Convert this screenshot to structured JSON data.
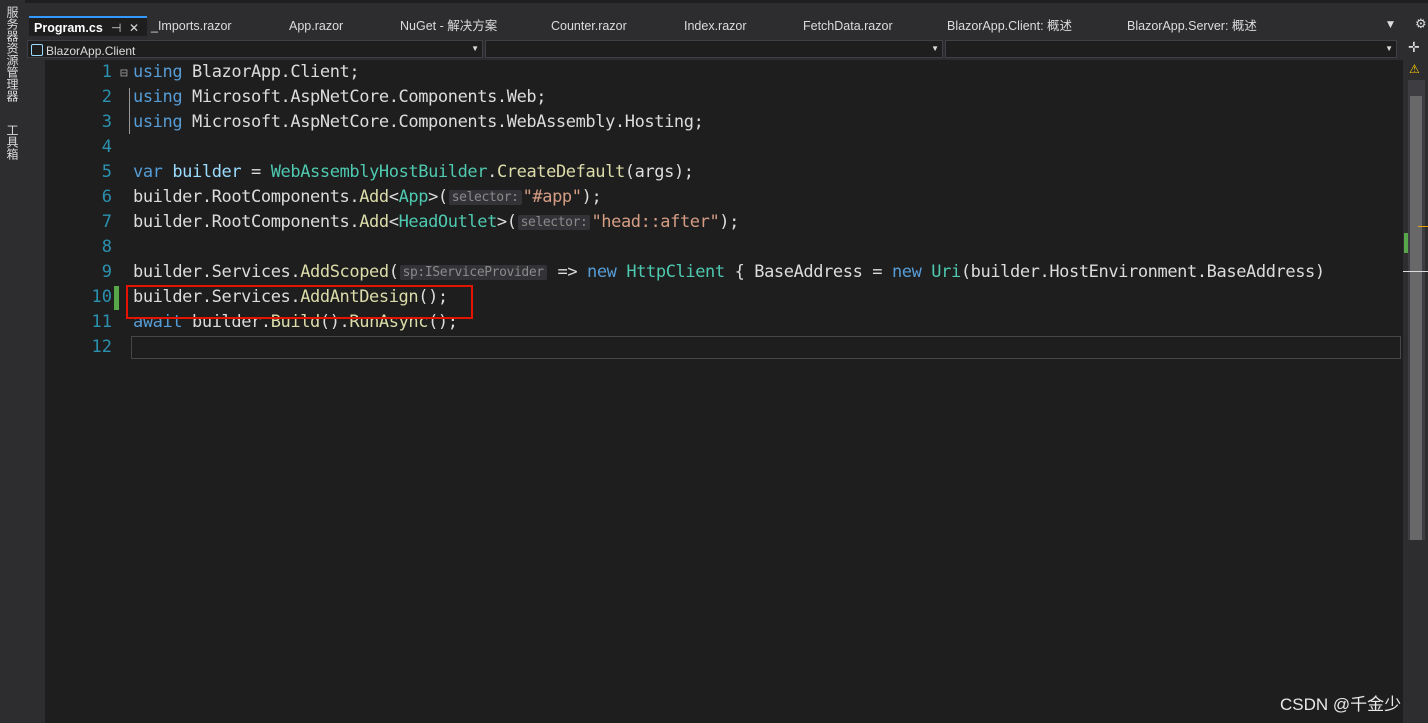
{
  "side_panels": [
    "服务器资源管理器",
    "工具箱"
  ],
  "tabs": [
    {
      "label": "Program.cs",
      "active": true,
      "pin": "⊣",
      "close": "✕"
    },
    {
      "label": "_Imports.razor"
    },
    {
      "label": "App.razor"
    },
    {
      "label": "NuGet - 解决方案"
    },
    {
      "label": "Counter.razor"
    },
    {
      "label": "Index.razor"
    },
    {
      "label": "FetchData.razor"
    },
    {
      "label": "BlazorApp.Client: 概述"
    },
    {
      "label": "BlazorApp.Server: 概述"
    }
  ],
  "nav": {
    "project": "BlazorApp.Client",
    "type_member": "",
    "member": ""
  },
  "code": {
    "line_numbers": [
      "1",
      "2",
      "3",
      "4",
      "5",
      "6",
      "7",
      "8",
      "9",
      "10",
      "11",
      "12"
    ],
    "l1": {
      "kw": "using",
      "rest": " BlazorApp.Client;"
    },
    "l2": {
      "kw": "using",
      "rest": " Microsoft.AspNetCore.Components.Web;"
    },
    "l3": {
      "kw": "using",
      "rest": " Microsoft.AspNetCore.Components.WebAssembly.Hosting;"
    },
    "l5": {
      "kw": "var",
      "var": " builder",
      "eq": " = ",
      "type": "WebAssemblyHostBuilder",
      "dot": ".",
      "fn": "CreateDefault",
      "args": "(args);"
    },
    "l6": {
      "pre": "builder.RootComponents.",
      "fn": "Add",
      "lt": "<",
      "type": "App",
      "gt": ">(",
      "hint": "selector:",
      "str": "\"#app\"",
      "end": ");"
    },
    "l7": {
      "pre": "builder.RootComponents.",
      "fn": "Add",
      "lt": "<",
      "type": "HeadOutlet",
      "gt": ">(",
      "hint": "selector:",
      "str": "\"head::after\"",
      "end": ");"
    },
    "l9": {
      "pre": "builder.Services.",
      "fn": "AddScoped",
      "open": "(",
      "hint": "sp:IServiceProvider",
      "arrow": " => ",
      "kw_new": "new",
      "sp1": " ",
      "type1": "HttpClient",
      "mid": " { BaseAddress = ",
      "kw_new2": "new",
      "sp2": " ",
      "type2": "Uri",
      "tail": "(builder.HostEnvironment.BaseAddress)"
    },
    "l10": {
      "pre": "builder.Services.",
      "fn": "AddAntDesign",
      "end": "();"
    },
    "l11": {
      "kw": "await",
      "rest": " builder.",
      "fn1": "Build",
      "mid": "().",
      "fn2": "RunAsync",
      "end": "();"
    }
  },
  "fold_marker": "⊟",
  "warning_icon": "⚠",
  "watermark": "CSDN @千金少"
}
